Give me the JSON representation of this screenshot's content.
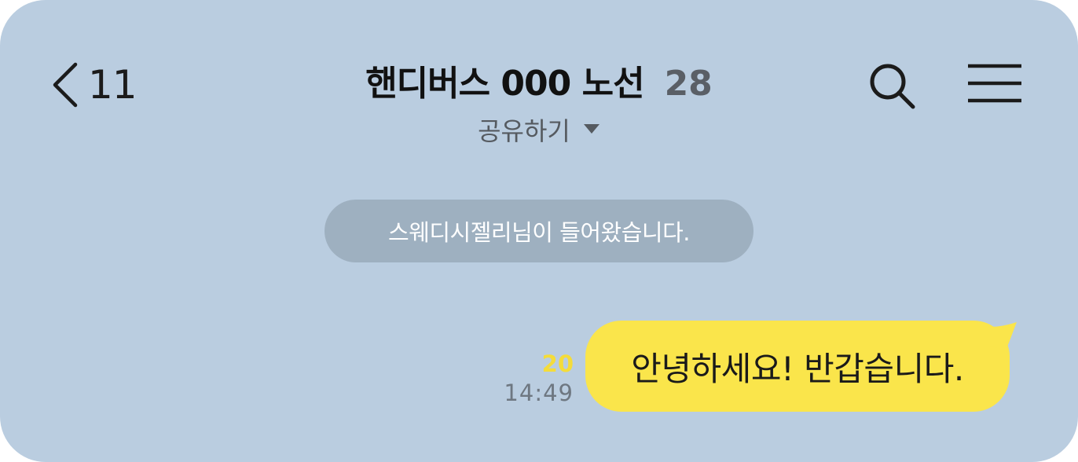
{
  "header": {
    "back_count": "11",
    "title": "핸디버스 000 노선",
    "member_count": "28",
    "share_label": "공유하기"
  },
  "icons": {
    "back": "chevron-left-icon",
    "share_caret": "caret-down-icon",
    "search": "search-icon",
    "menu": "hamburger-menu-icon"
  },
  "notice": {
    "text": "스웨디시젤리님이 들어왔습니다."
  },
  "message": {
    "text": "안녕하세요! 반갑습니다.",
    "unread_count": "20",
    "time": "14:49"
  },
  "colors": {
    "background": "#bacde0",
    "bubble": "#fae54b",
    "notice": "#9eb0c0",
    "unread": "#f4dc3a"
  }
}
